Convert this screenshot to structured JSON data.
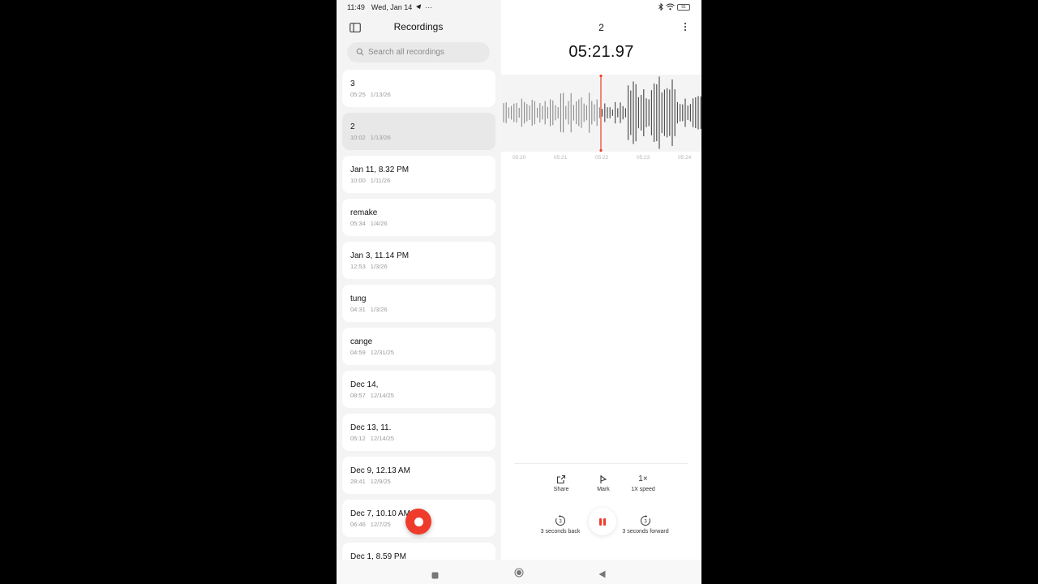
{
  "status": {
    "time": "11:49",
    "date": "Wed, Jan 14",
    "overflow": "···",
    "battery": "91"
  },
  "left": {
    "title": "Recordings",
    "search_placeholder": "Search all recordings"
  },
  "recordings": [
    {
      "name": "3",
      "duration": "05:25",
      "date": "1/13/26",
      "selected": false
    },
    {
      "name": "2",
      "duration": "10:02",
      "date": "1/13/26",
      "selected": true
    },
    {
      "name": "Jan 11, 8.32 PM",
      "duration": "10:00",
      "date": "1/11/26",
      "selected": false
    },
    {
      "name": "remake",
      "duration": "05:34",
      "date": "1/4/26",
      "selected": false
    },
    {
      "name": "Jan 3, 11.14 PM",
      "duration": "12:53",
      "date": "1/3/26",
      "selected": false
    },
    {
      "name": "tung",
      "duration": "04:31",
      "date": "1/3/26",
      "selected": false
    },
    {
      "name": "cange",
      "duration": "04:59",
      "date": "12/31/25",
      "selected": false
    },
    {
      "name": "Dec 14,",
      "duration": "08:57",
      "date": "12/14/25",
      "selected": false
    },
    {
      "name": "Dec 13, 11.",
      "duration": "05:12",
      "date": "12/14/25",
      "selected": false
    },
    {
      "name": "Dec 9, 12.13 AM",
      "duration": "28:41",
      "date": "12/9/25",
      "selected": false
    },
    {
      "name": "Dec 7, 10.10 AM",
      "duration": "06:46",
      "date": "12/7/25",
      "selected": false
    },
    {
      "name": "Dec 1, 8.59 PM",
      "duration": "",
      "date": "",
      "selected": false
    }
  ],
  "player": {
    "title": "2",
    "elapsed": "05:21.97",
    "timeline_ticks": [
      "05:20",
      "05:21",
      "05:22",
      "05:23",
      "05:24"
    ],
    "accent_color": "#ee3b2c",
    "controls": {
      "share": "Share",
      "mark": "Mark",
      "speed_glyph": "1×",
      "speed": "1X speed",
      "back": "3 seconds back",
      "forward": "3 seconds forward",
      "skip_number": "3"
    }
  }
}
